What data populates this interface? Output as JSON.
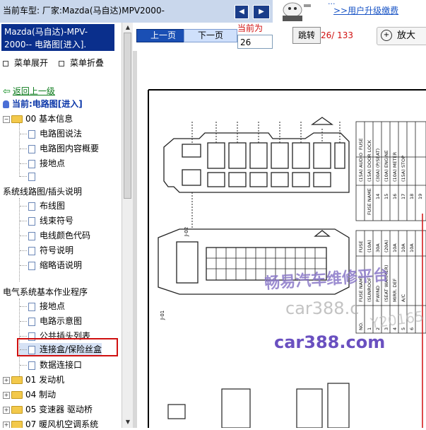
{
  "header": {
    "title": "当前车型:    厂家:Mazda(马自达)MPV2000-",
    "nav_prev_glyph": "◀",
    "nav_next_glyph": "▶",
    "upgrade_hint": "...",
    "upgrade_link": ">>用户升级缴费"
  },
  "sidebar": {
    "model_title": "Mazda(马自达)-MPV-2000-- 电路图[进入].",
    "expand_label": "菜单展开",
    "collapse_label": "菜单折叠",
    "back_label": "返回上一级",
    "current_label": "当前:电路图[进入]",
    "groups": [
      {
        "label": "00 基本信息",
        "items": [
          "电路图说法",
          "电路图内容概要",
          "接地点",
          ""
        ]
      },
      {
        "label": "系统线路图/插头说明",
        "items": [
          "布线图",
          "线束符号",
          "电线颜色代码",
          "符号说明",
          "缩略语说明"
        ]
      },
      {
        "label": "电气系统基本作业程序",
        "items": [
          "接地点",
          "电路示意图",
          "公共插头列表",
          "连接盒/保险丝盒",
          "数据连接口"
        ]
      }
    ],
    "folders": [
      "01 发动机",
      "04 制动",
      "05 变速器 驱动桥",
      "07 暖风机空调系统"
    ]
  },
  "toolbar": {
    "prev_label": "上一页",
    "next_label": "下一页",
    "current_page_label": "当前为",
    "current_page_value": "26",
    "goto_label": "跳转",
    "page_status": "26/ 133",
    "zoom_label": "放大"
  },
  "diagram": {
    "watermark_cn": "畅易汽车维修平台",
    "watermark_url": "car388.com",
    "watermark_faint": "car388.c",
    "watermark_code": "Y20165",
    "fuse_header": "FUSE",
    "fuse_name_header": "FUSE NAME",
    "fuse_rows": [
      "(15A) AUDIO",
      "(15A) DOOR LOCK",
      "(30A) (P/SEAT)",
      "(10A) ENGINE",
      "(10A) METER",
      "(15A) STOP"
    ],
    "fuse_nos": [
      "14",
      "15",
      "16",
      "17",
      "18",
      "19"
    ],
    "left_nos": [
      "NO.",
      "1",
      "2",
      "3",
      "4",
      "5",
      "6"
    ],
    "left_names": [
      "FUSE NAME",
      "(SUNROOF)",
      "P.WIND",
      "(SEAT WARMER)",
      "MIRR. DEF",
      "A/C"
    ],
    "left_amps": [
      "FUSE",
      "(10A)",
      "30A",
      "(20A)",
      "10A",
      "10A",
      "10A"
    ],
    "connector_label_top": "J-02",
    "connector_label_bottom": "J-01"
  }
}
